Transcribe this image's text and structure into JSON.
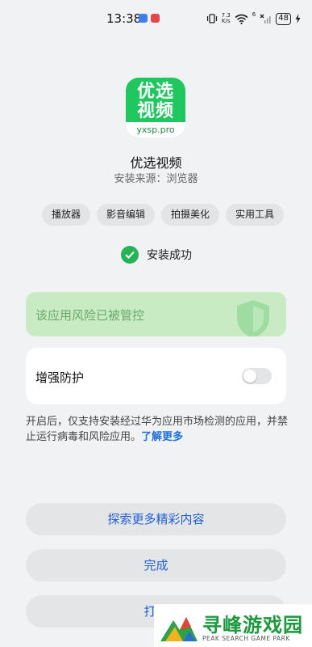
{
  "status_bar": {
    "time": "13:38",
    "network_speed_value": "7.3",
    "network_speed_unit": "K/s",
    "signal_label": "6",
    "battery": "48"
  },
  "app": {
    "icon_text_line1": "优选",
    "icon_text_line2": "视频",
    "icon_domain": "yxsp.pro",
    "name": "优选视频",
    "source": "安装来源：浏览器"
  },
  "tags": [
    "播放器",
    "影音编辑",
    "拍摄美化",
    "实用工具"
  ],
  "status": {
    "success_text": "安装成功"
  },
  "risk_banner": {
    "text": "该应用风险已被管控"
  },
  "protection": {
    "label": "增强防护",
    "enabled": false
  },
  "description": {
    "text": "开启后，仅支持安装经过华为应用市场检测的应用，并禁止运行病毒和风险应用。",
    "link": "了解更多"
  },
  "buttons": {
    "explore": "探索更多精彩内容",
    "done": "完成",
    "open": "打开"
  },
  "watermark": {
    "title": "寻峰游戏园",
    "subtitle": "PEAK SEARCH GAME PARK"
  },
  "colors": {
    "accent_blue": "#1f5fd6",
    "success_green": "#25b358",
    "risk_bg": "#c9ebc4",
    "app_icon_green": "#1fc85f"
  }
}
